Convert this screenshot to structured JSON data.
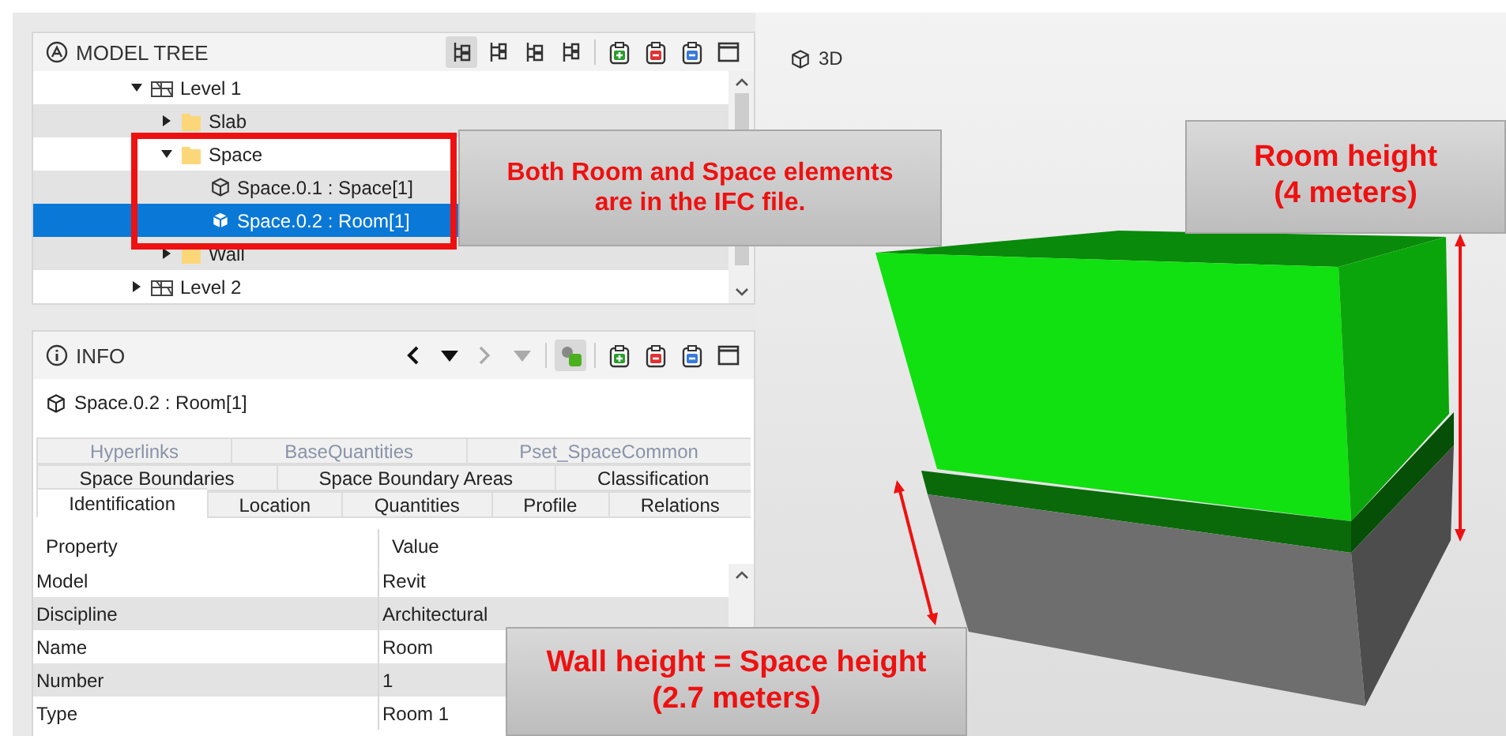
{
  "model_tree": {
    "title": "MODEL TREE",
    "toolbar": [
      {
        "kind": "tree",
        "pressed": true
      },
      {
        "kind": "tree",
        "pressed": false
      },
      {
        "kind": "tree",
        "pressed": false
      },
      {
        "kind": "tree",
        "pressed": false
      },
      {
        "kind": "add",
        "pressed": false
      },
      {
        "kind": "remove",
        "pressed": false
      },
      {
        "kind": "clear",
        "pressed": false
      },
      {
        "kind": "window",
        "pressed": false
      }
    ],
    "items": [
      {
        "label": "Level 1",
        "kind": "level",
        "expanded": true,
        "selected": false,
        "children": [
          {
            "label": "Slab",
            "kind": "folder",
            "expanded": false,
            "selected": false
          },
          {
            "label": "Space",
            "kind": "folder",
            "expanded": true,
            "selected": false,
            "children": [
              {
                "label": "Space.0.1 : Space[1]",
                "kind": "element",
                "selected": false
              },
              {
                "label": "Space.0.2 : Room[1]",
                "kind": "element",
                "selected": true
              }
            ]
          },
          {
            "label": "Wall",
            "kind": "folder",
            "expanded": false,
            "selected": false
          }
        ]
      },
      {
        "label": "Level 2",
        "kind": "level",
        "expanded": false,
        "selected": false
      }
    ]
  },
  "view": {
    "title": "3D"
  },
  "info": {
    "title": "INFO",
    "nav": [
      {
        "kind": "back",
        "disabled": false
      },
      {
        "kind": "menu",
        "disabled": false
      },
      {
        "kind": "forward",
        "disabled": true
      },
      {
        "kind": "menu",
        "disabled": true
      }
    ],
    "toolbar": [
      {
        "kind": "highlight",
        "pressed": true
      },
      {
        "kind": "add",
        "pressed": false
      },
      {
        "kind": "remove",
        "pressed": false
      },
      {
        "kind": "clear",
        "pressed": false
      },
      {
        "kind": "window",
        "pressed": false
      }
    ],
    "element": "Space.0.2 : Room[1]",
    "tab_rows": [
      [
        {
          "label": "Hyperlinks",
          "selected": false,
          "disabled": true
        },
        {
          "label": "BaseQuantities",
          "selected": false,
          "disabled": true
        },
        {
          "label": "Pset_SpaceCommon",
          "selected": false,
          "disabled": true
        }
      ],
      [
        {
          "label": "Space Boundaries",
          "selected": false,
          "disabled": false
        },
        {
          "label": "Space Boundary Areas",
          "selected": false,
          "disabled": false
        },
        {
          "label": "Classification",
          "selected": false,
          "disabled": false
        }
      ],
      [
        {
          "label": "Identification",
          "selected": true,
          "disabled": false
        },
        {
          "label": "Location",
          "selected": false,
          "disabled": false
        },
        {
          "label": "Quantities",
          "selected": false,
          "disabled": false
        },
        {
          "label": "Profile",
          "selected": false,
          "disabled": false
        },
        {
          "label": "Relations",
          "selected": false,
          "disabled": false
        }
      ]
    ],
    "table": {
      "columns": [
        "Property",
        "Value"
      ],
      "rows": [
        [
          "Model",
          "Revit"
        ],
        [
          "Discipline",
          "Architectural"
        ],
        [
          "Name",
          "Room"
        ],
        [
          "Number",
          "1"
        ],
        [
          "Type",
          "Room 1"
        ]
      ]
    }
  },
  "callouts": [
    {
      "kind": "ifc",
      "lines": [
        "Both Room and Space elements",
        "are in the IFC file."
      ]
    },
    {
      "kind": "room",
      "lines": [
        "Room height",
        "(4 meters)"
      ]
    },
    {
      "kind": "wall",
      "lines": [
        "Wall height = Space height",
        "(2.7 meters)"
      ]
    }
  ]
}
